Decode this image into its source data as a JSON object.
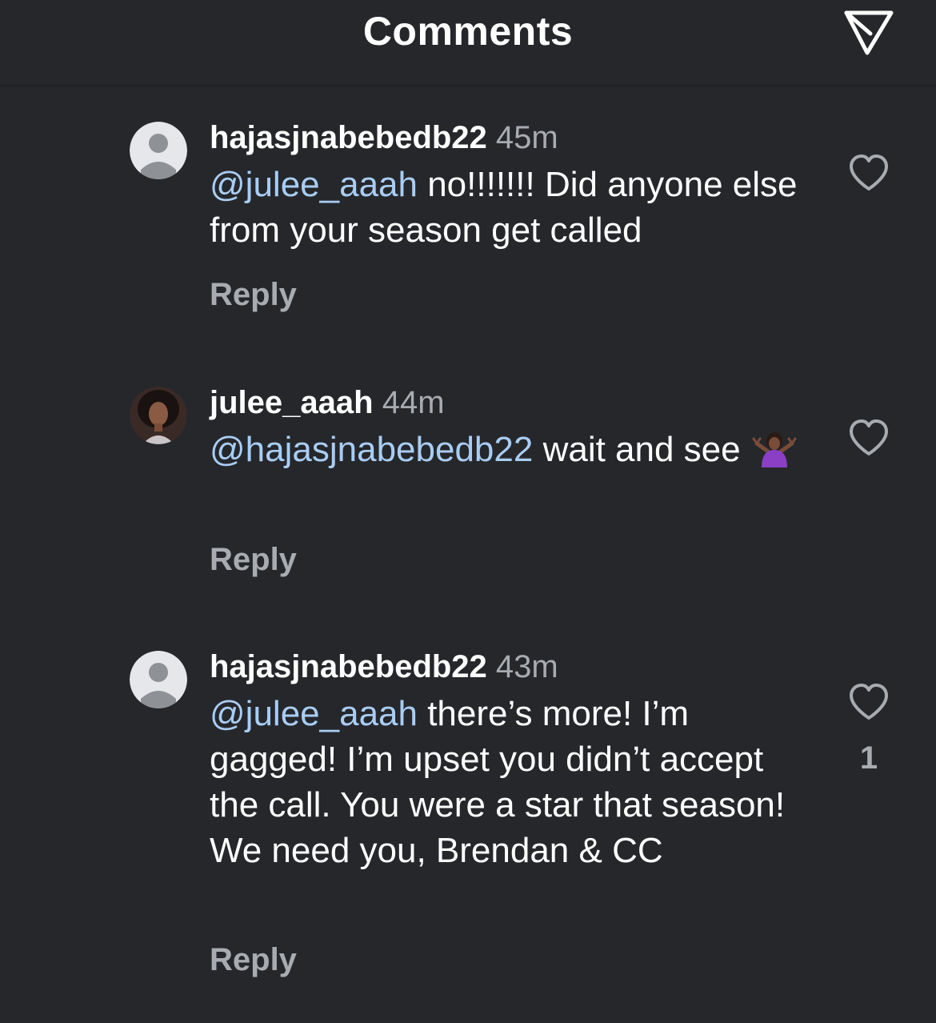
{
  "header": {
    "title": "Comments",
    "share_icon": "paper-plane-icon"
  },
  "comments": [
    {
      "username": "hajasjnabebedb22",
      "time": "45m",
      "mention": "@julee_aaah",
      "text": " no!!!!!!! Did anyone else from your season get called",
      "reply_label": "Reply",
      "avatar": "default-avatar-icon",
      "like_icon": "heart-outline-icon",
      "like_count": ""
    },
    {
      "username": "julee_aaah",
      "time": "44m",
      "mention": "@hajasjnabebedb22",
      "text": " wait and see",
      "emoji": "🤷🏾‍♀️",
      "reply_label": "Reply",
      "avatar": "profile-photo",
      "like_icon": "heart-outline-icon",
      "like_count": ""
    },
    {
      "username": "hajasjnabebedb22",
      "time": "43m",
      "mention": "@julee_aaah",
      "text": " there’s more! I’m gagged! I’m upset you didn’t accept the call. You were a star that season! We need you, Brendan & CC",
      "reply_label": "Reply",
      "avatar": "default-avatar-icon",
      "like_icon": "heart-outline-icon",
      "like_count": "1"
    }
  ],
  "colors": {
    "background": "#25272b",
    "mention": "#a9cdf3",
    "secondary_text": "#a8abb0",
    "primary_text": "#ffffff"
  }
}
